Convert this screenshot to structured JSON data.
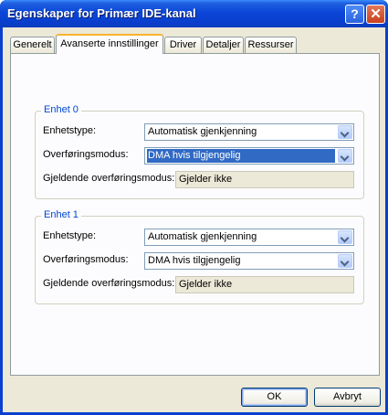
{
  "window": {
    "title": "Egenskaper for Primær IDE-kanal"
  },
  "title_buttons": {
    "help": "?",
    "close": "✕"
  },
  "tabs": [
    {
      "label": "Generelt",
      "active": false
    },
    {
      "label": "Avanserte innstillinger",
      "active": true
    },
    {
      "label": "Driver",
      "active": false
    },
    {
      "label": "Detaljer",
      "active": false
    },
    {
      "label": "Ressurser",
      "active": false
    }
  ],
  "groups": [
    {
      "title": "Enhet 0",
      "device_type_label": "Enhetstype:",
      "device_type_value": "Automatisk gjenkjenning",
      "transfer_mode_label": "Overføringsmodus:",
      "transfer_mode_value": "DMA hvis tilgjengelig",
      "current_mode_label": "Gjeldende overføringsmodus:",
      "current_mode_value": "Gjelder ikke"
    },
    {
      "title": "Enhet 1",
      "device_type_label": "Enhetstype:",
      "device_type_value": "Automatisk gjenkjenning",
      "transfer_mode_label": "Overføringsmodus:",
      "transfer_mode_value": "DMA hvis tilgjengelig",
      "current_mode_label": "Gjeldende overføringsmodus:",
      "current_mode_value": "Gjelder ikke"
    }
  ],
  "buttons": {
    "ok": "OK",
    "cancel": "Avbryt"
  },
  "colors": {
    "titlebar": "#0a3fd0",
    "group_title": "#0046d5",
    "selection": "#316ac5",
    "dialog_bg": "#ece9d8"
  }
}
